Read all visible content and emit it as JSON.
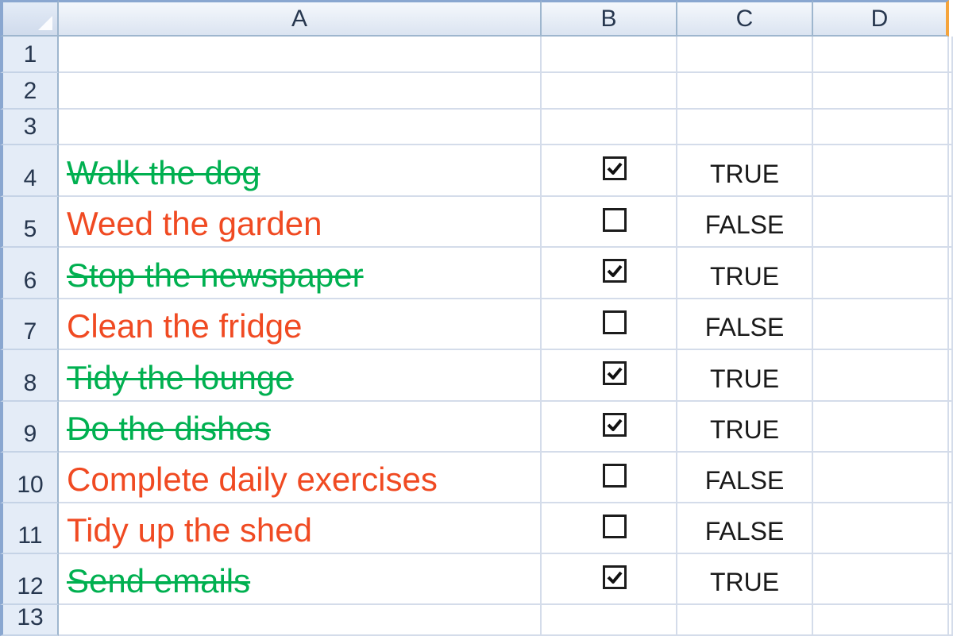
{
  "columns": [
    "A",
    "B",
    "C",
    "D"
  ],
  "row_numbers": [
    "1",
    "2",
    "3",
    "4",
    "5",
    "6",
    "7",
    "8",
    "9",
    "10",
    "11",
    "12",
    "13"
  ],
  "tasks": [
    {
      "row": "4",
      "label": "Walk the dog",
      "done": true,
      "value": "TRUE"
    },
    {
      "row": "5",
      "label": "Weed the garden",
      "done": false,
      "value": "FALSE"
    },
    {
      "row": "6",
      "label": "Stop the newspaper",
      "done": true,
      "value": "TRUE"
    },
    {
      "row": "7",
      "label": "Clean the fridge",
      "done": false,
      "value": "FALSE"
    },
    {
      "row": "8",
      "label": "Tidy the lounge",
      "done": true,
      "value": "TRUE"
    },
    {
      "row": "9",
      "label": "Do the dishes",
      "done": true,
      "value": "TRUE"
    },
    {
      "row": "10",
      "label": "Complete daily exercises",
      "done": false,
      "value": "FALSE"
    },
    {
      "row": "11",
      "label": "Tidy up the shed",
      "done": false,
      "value": "FALSE"
    },
    {
      "row": "12",
      "label": "Send emails",
      "done": true,
      "value": "TRUE"
    }
  ],
  "colors": {
    "done": "#00b050",
    "todo": "#f04a22",
    "selection_edge": "#f5a43b"
  }
}
